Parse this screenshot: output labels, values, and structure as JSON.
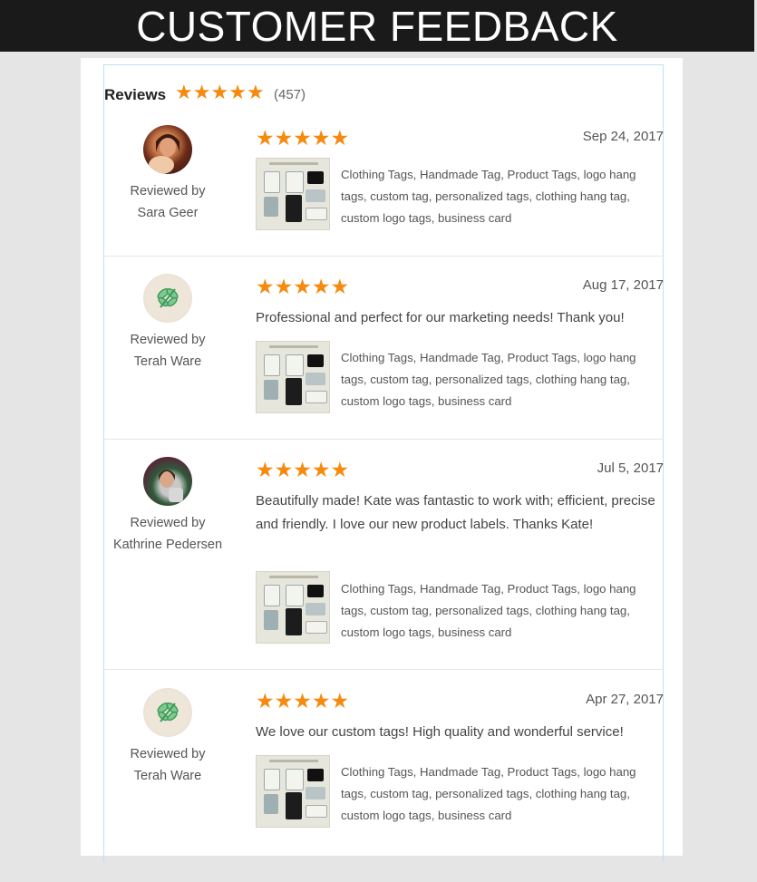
{
  "banner": {
    "title": "CUSTOMER FEEDBACK"
  },
  "reviews_header": {
    "title": "Reviews",
    "rating_stars": 5,
    "count": "(457)"
  },
  "colors": {
    "star": "#f58a0f",
    "banner_bg": "#1a1a1a",
    "frame_border": "#bfe2ee"
  },
  "reviews": [
    {
      "reviewed_by_label": "Reviewed by",
      "reviewer": "Sara Geer",
      "avatar_icon": "user-photo",
      "stars": 5,
      "date": "Sep 24, 2017",
      "text": "",
      "item_title": "Clothing Tags, Handmade Tag, Product Tags, logo hang tags, custom tag, personalized tags, clothing hang tag, custom logo tags, business card"
    },
    {
      "reviewed_by_label": "Reviewed by",
      "reviewer": "Terah Ware",
      "avatar_icon": "dragonfly-avatar",
      "stars": 5,
      "date": "Aug 17, 2017",
      "text": "Professional and perfect for our marketing needs! Thank you!",
      "item_title": "Clothing Tags, Handmade Tag, Product Tags, logo hang tags, custom tag, personalized tags, clothing hang tag, custom logo tags, business card"
    },
    {
      "reviewed_by_label": "Reviewed by",
      "reviewer": "Kathrine Pedersen",
      "avatar_icon": "user-photo",
      "stars": 5,
      "date": "Jul 5, 2017",
      "text": "Beautifully made! Kate was fantastic to work with; efficient, precise and friendly. I love our new product labels. Thanks Kate!",
      "item_title": "Clothing Tags, Handmade Tag, Product Tags, logo hang tags, custom tag, personalized tags, clothing hang tag, custom logo tags, business card"
    },
    {
      "reviewed_by_label": "Reviewed by",
      "reviewer": "Terah Ware",
      "avatar_icon": "dragonfly-avatar",
      "stars": 5,
      "date": "Apr 27, 2017",
      "text": "We love our custom tags! High quality and wonderful service!",
      "item_title": "Clothing Tags, Handmade Tag, Product Tags, logo hang tags, custom tag, personalized tags, clothing hang tag, custom logo tags, business card"
    }
  ]
}
